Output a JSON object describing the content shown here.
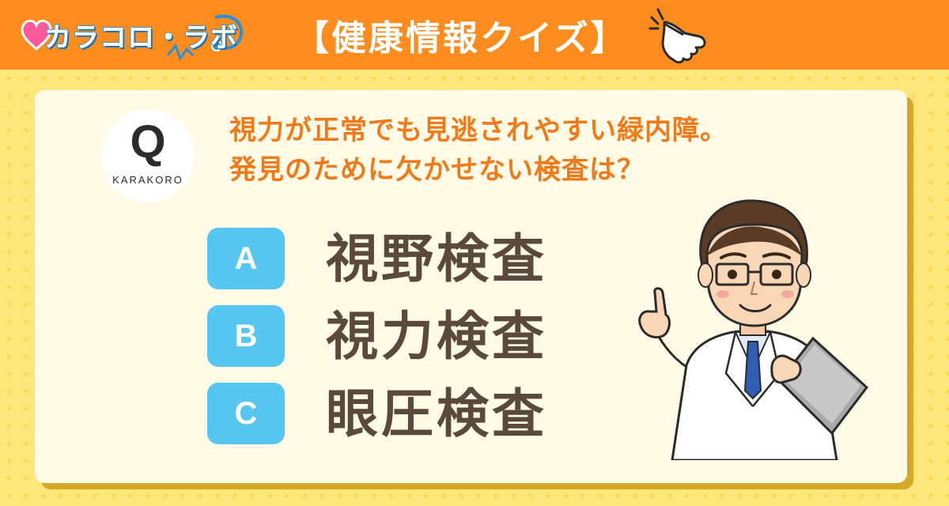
{
  "header": {
    "logo_text": "カラコロ・ラボ",
    "title": "【健康情報クイズ】",
    "hand_icon": "pointing-hand-icon"
  },
  "badge": {
    "letter": "Q",
    "sub": "KARAKORO"
  },
  "question": {
    "line1": "視力が正常でも見逃されやすい緑内障。",
    "line2": "発見のために欠かせない検査は？"
  },
  "choices": [
    {
      "letter": "A",
      "text": "視野検査"
    },
    {
      "letter": "B",
      "text": "視力検査"
    },
    {
      "letter": "C",
      "text": "眼圧検査"
    }
  ],
  "colors": {
    "header_orange": "#fd8c1f",
    "background_yellow": "#fde77a",
    "question_orange": "#f07a19",
    "choice_blue": "#56c7f0",
    "choice_text_brown": "#5b4a3b"
  },
  "illustration": "doctor-illustration"
}
